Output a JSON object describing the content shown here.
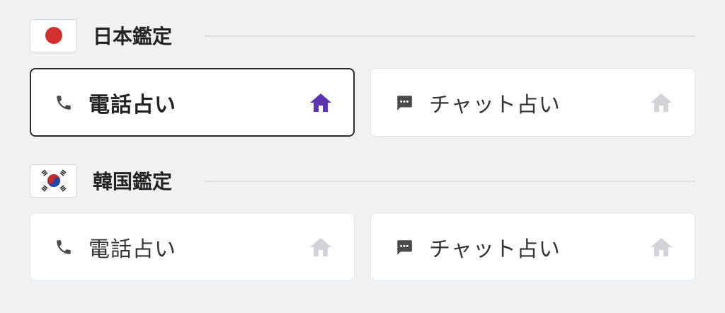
{
  "sections": [
    {
      "title": "日本鑑定",
      "flag_icon": "japan-flag-icon",
      "cards": [
        {
          "label": "電話占い",
          "icon": "phone-icon",
          "selected": true,
          "home_icon_color": "#5b35b5"
        },
        {
          "label": "チャット占い",
          "icon": "chat-icon",
          "selected": false,
          "home_icon_color": "#d2d3d6"
        }
      ]
    },
    {
      "title": "韓国鑑定",
      "flag_icon": "korea-flag-icon",
      "cards": [
        {
          "label": "電話占い",
          "icon": "phone-icon",
          "selected": false,
          "home_icon_color": "#d2d3d6"
        },
        {
          "label": "チャット占い",
          "icon": "chat-icon",
          "selected": false,
          "home_icon_color": "#d2d3d6"
        }
      ]
    }
  ],
  "colors": {
    "background": "#f0f1f3",
    "card_background": "#ffffff",
    "accent_purple": "#5b35b5",
    "inactive_home": "#d2d3d6",
    "selected_border": "#2b2b2b"
  }
}
